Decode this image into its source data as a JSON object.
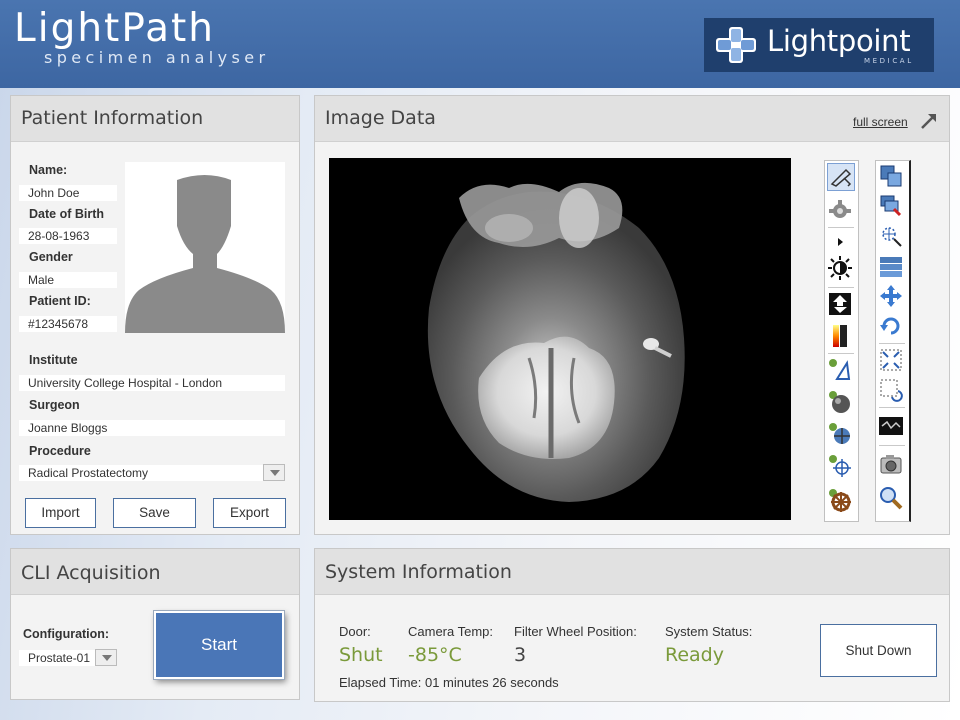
{
  "app": {
    "title": "LightPath",
    "subtitle": "specimen analyser",
    "logo_text_a": "Light",
    "logo_text_b": "point",
    "logo_sub": "MEDICAL"
  },
  "patient": {
    "title": "Patient Information",
    "name_label": "Name:",
    "name_value": "John Doe",
    "dob_label": "Date of Birth",
    "dob_value": "28-08-1963",
    "gender_label": "Gender",
    "gender_value": "Male",
    "pid_label": "Patient ID:",
    "pid_value": "#12345678",
    "institute_label": "Institute",
    "institute_value": "University College Hospital - London",
    "surgeon_label": "Surgeon",
    "surgeon_value": "Joanne Bloggs",
    "procedure_label": "Procedure",
    "procedure_value": "Radical Prostatectomy",
    "import_label": "Import",
    "save_label": "Save",
    "export_label": "Export"
  },
  "image": {
    "title": "Image Data",
    "full_screen_label": "full screen",
    "toolbar_left": [
      "pointer-icon",
      "gear-icon",
      "play-arrow-icon",
      "brightness-icon",
      "flip-icon",
      "color-scale-icon",
      "angle-measure-icon",
      "sphere-icon",
      "globe-marker-icon",
      "crosshair-marker-icon",
      "ship-wheel-icon"
    ],
    "toolbar_right": [
      "layers-icon",
      "layers-red-icon",
      "zoom-region-icon",
      "stack-icon",
      "move-icon",
      "rotate-icon",
      "fit-icon",
      "rotate-region-icon",
      "filmstrip-icon",
      "camera-icon",
      "magnifier-icon"
    ]
  },
  "cli": {
    "title": "CLI Acquisition",
    "config_label": "Configuration:",
    "config_value": "Prostate-01",
    "start_label": "Start"
  },
  "system": {
    "title": "System Information",
    "door_label": "Door:",
    "door_value": "Shut",
    "camera_label": "Camera Temp:",
    "camera_value": "-85°C",
    "filter_label": "Filter Wheel Position:",
    "filter_value": "3",
    "status_label": "System Status:",
    "status_value": "Ready",
    "elapsed": "Elapsed Time: 01 minutes 26 seconds",
    "shutdown_label": "Shut Down"
  },
  "colors": {
    "header_blue": "#3d66a2",
    "start_blue": "#4a76b7",
    "status_green": "#7a9a3a"
  }
}
